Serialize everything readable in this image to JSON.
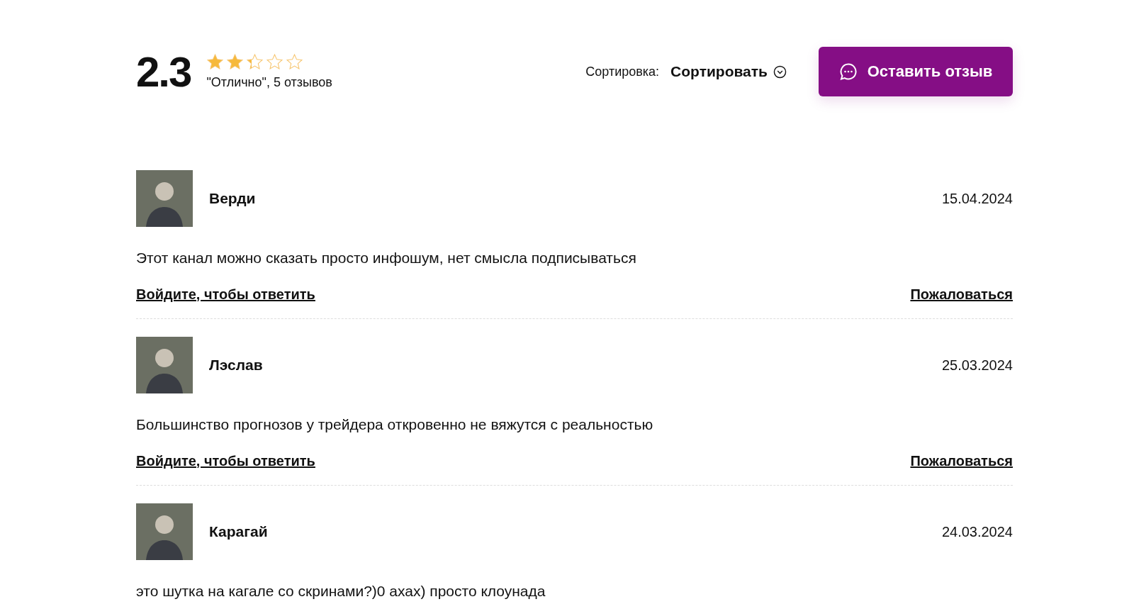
{
  "summary": {
    "score": "2.3",
    "stars": 2.3,
    "caption": "\"Отлично\", 5 отзывов"
  },
  "sort": {
    "label": "Сортировка:",
    "value": "Сортировать"
  },
  "leave_review_button": "Оставить отзыв",
  "reviews": [
    {
      "name": "Верди",
      "date": "15.04.2024",
      "text": "Этот канал можно сказать просто инфошум, нет смысла подписываться",
      "reply_link": "Войдите, чтобы ответить",
      "report_link": "Пожаловаться"
    },
    {
      "name": "Лэслав",
      "date": "25.03.2024",
      "text": "Большинство прогнозов у трейдера откровенно не вяжутся с реальностью",
      "reply_link": "Войдите, чтобы ответить",
      "report_link": "Пожаловаться"
    },
    {
      "name": "Карагай",
      "date": "24.03.2024",
      "text": "это шутка на кагале со скринами?)0 ахах) просто клоунада"
    }
  ]
}
